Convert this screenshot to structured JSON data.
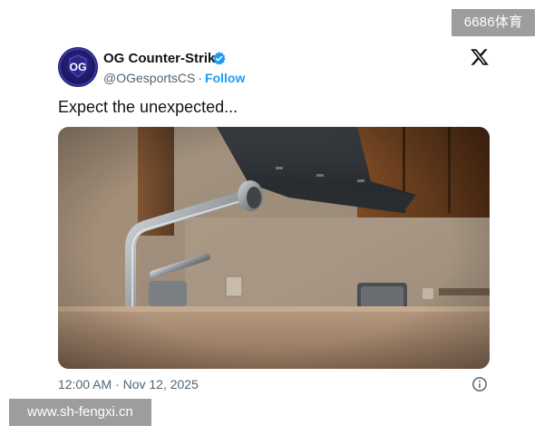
{
  "watermarks": {
    "top_right": "6686体育",
    "bottom_left": "www.sh-fengxi.cn"
  },
  "tweet": {
    "author_name": "OG Counter-Strike",
    "handle": "@OGesportsCS",
    "separator": "·",
    "follow_label": "Follow",
    "text": "Expect the unexpected...",
    "timestamp": "12:00 AM · Nov 12, 2025",
    "avatar_logo_text": "OG"
  },
  "icons": {
    "verified": "verified-badge-icon",
    "platform": "x-logo-icon",
    "info": "info-icon"
  },
  "colors": {
    "accent": "#1d9bf0",
    "text_primary": "#0f1419",
    "text_secondary": "#536471",
    "avatar_bg": "#1c1760"
  }
}
